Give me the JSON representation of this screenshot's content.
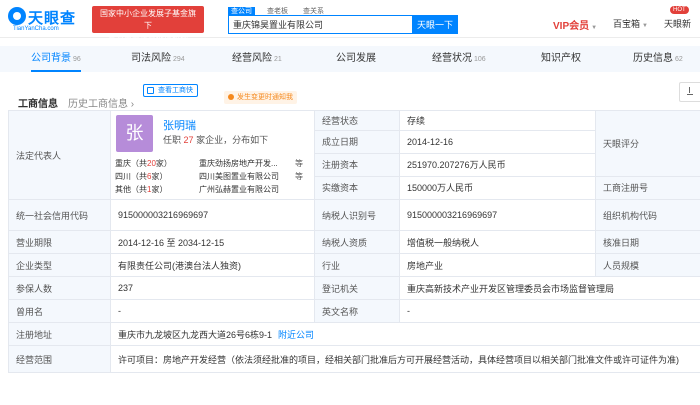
{
  "header": {
    "logo_text": "天眼查",
    "logo_domain": "TianYanCha.com",
    "promo_line1": "国家中小企业发展子基金旗下",
    "promo_line2": "官方备案企业征信机构",
    "search_tabs": [
      "查公司",
      "查老板",
      "查关系"
    ],
    "search_value": "重庆锦昊置业有限公司",
    "search_button": "天眼一下",
    "vip_label": "VIP会员",
    "nav_a": "百宝箱",
    "hot_badge": "HOT",
    "nav_b": "天眼新"
  },
  "tabs": [
    {
      "label": "公司背景",
      "count": "96",
      "active": true
    },
    {
      "label": "司法风险",
      "count": "294"
    },
    {
      "label": "经营风险",
      "count": "21"
    },
    {
      "label": "公司发展",
      "count": ""
    },
    {
      "label": "经营状况",
      "count": "106"
    },
    {
      "label": "知识产权",
      "count": ""
    },
    {
      "label": "历史信息",
      "count": "62"
    }
  ],
  "section": {
    "title": "工商信息",
    "history": "历史工商信息",
    "history_arrow": "›",
    "view_badge": "查看工商快",
    "change_badge": "发生变更时通知我"
  },
  "legal_rep": {
    "label": "法定代表人",
    "avatar_char": "张",
    "name": "张明瑞",
    "sub_prefix": "任职",
    "sub_count": "27",
    "sub_suffix": "家企业，分布如下",
    "rows": [
      {
        "loc": "重庆",
        "count": "20",
        "company": "重庆劲扬房地产开发...",
        "etc": "等"
      },
      {
        "loc": "四川",
        "count": "6",
        "company": "四川美图置业有限公司",
        "etc": "等"
      },
      {
        "loc": "其他",
        "count": "1",
        "company": "广州弘赫置业有限公司",
        "etc": ""
      }
    ]
  },
  "fields": {
    "status_label": "经营状态",
    "status": "存续",
    "founded_label": "成立日期",
    "founded": "2014-12-16",
    "reg_capital_label": "注册资本",
    "reg_capital": "251970.207276万人民币",
    "paid_capital_label": "实缴资本",
    "paid_capital": "150000万人民币",
    "rating_label": "天眼评分",
    "reg_no_label": "工商注册号",
    "credit_code_label": "统一社会信用代码",
    "credit_code": "915000003216969697",
    "taxpayer_id_label": "纳税人识别号",
    "taxpayer_id": "915000003216969697",
    "org_code_label": "组织机构代码",
    "term_label": "营业期限",
    "term": "2014-12-16 至 2034-12-15",
    "taxpayer_type_label": "纳税人资质",
    "taxpayer_type": "增值税一般纳税人",
    "approval_date_label": "核准日期",
    "company_type_label": "企业类型",
    "company_type": "有限责任公司(港澳台法人独资)",
    "industry_label": "行业",
    "industry": "房地产业",
    "scale_label": "人员规模",
    "insured_label": "参保人数",
    "insured": "237",
    "authority_label": "登记机关",
    "authority": "重庆高新技术产业开发区管理委员会市场监督管理局",
    "former_name_label": "曾用名",
    "former_name": "-",
    "english_name_label": "英文名称",
    "english_name": "-",
    "address_label": "注册地址",
    "address": "重庆市九龙坡区九龙西大道26号6栋9-1",
    "address_link": "附近公司",
    "scope_label": "经营范围",
    "scope": "许可项目：房地产开发经营（依法须经批准的项目，经相关部门批准后方可开展经营活动，具体经营项目以相关部门批准文件或许可证件为准)"
  }
}
